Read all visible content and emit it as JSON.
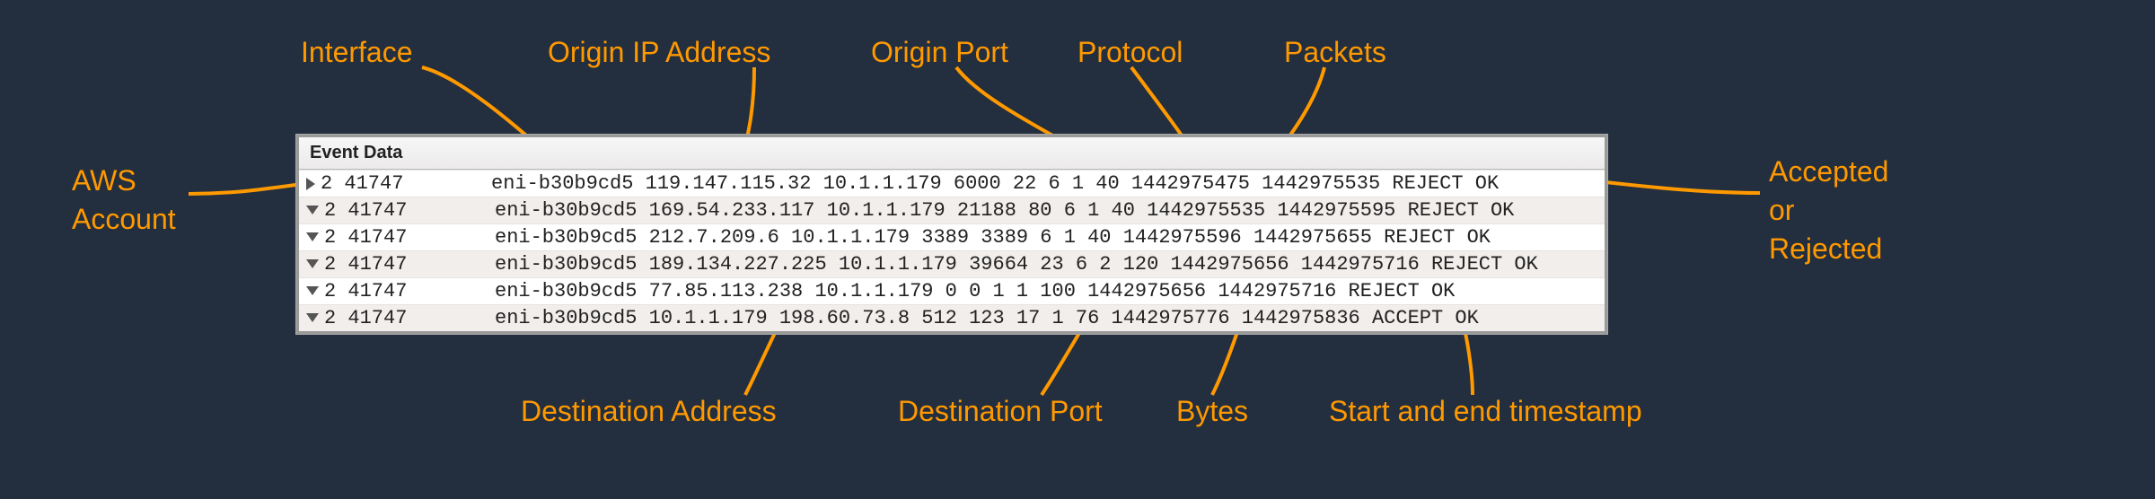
{
  "labels": {
    "interface": "Interface",
    "origin_ip": "Origin IP Address",
    "origin_port": "Origin Port",
    "protocol": "Protocol",
    "packets": "Packets",
    "aws_account": "AWS\nAccount",
    "accepted": "Accepted\nor\nRejected",
    "dest_addr": "Destination Address",
    "dest_port": "Destination Port",
    "bytes": "Bytes",
    "timestamps": "Start and end timestamp"
  },
  "panel": {
    "title": "Event Data",
    "rows": [
      {
        "expand": "right",
        "account": "2 41747",
        "log": "eni-b30b9cd5 119.147.115.32 10.1.1.179 6000 22 6 1 40 1442975475 1442975535 REJECT OK"
      },
      {
        "expand": "down",
        "account": "2 41747",
        "log": "eni-b30b9cd5 169.54.233.117 10.1.1.179 21188 80 6 1 40 1442975535 1442975595 REJECT OK"
      },
      {
        "expand": "down",
        "account": "2 41747",
        "log": "eni-b30b9cd5 212.7.209.6 10.1.1.179 3389 3389 6 1 40 1442975596 1442975655 REJECT OK"
      },
      {
        "expand": "down",
        "account": "2 41747",
        "log": "eni-b30b9cd5 189.134.227.225 10.1.1.179 39664 23 6 2 120 1442975656 1442975716 REJECT OK"
      },
      {
        "expand": "down",
        "account": "2 41747",
        "log": "eni-b30b9cd5 77.85.113.238 10.1.1.179 0 0 1 1 100 1442975656 1442975716 REJECT OK"
      },
      {
        "expand": "down",
        "account": "2 41747",
        "log": "eni-b30b9cd5 10.1.1.179 198.60.73.8 512 123 17 1 76 1442975776 1442975836 ACCEPT OK"
      }
    ]
  },
  "colors": {
    "accent": "#ff9900",
    "bg": "#232f3e"
  }
}
